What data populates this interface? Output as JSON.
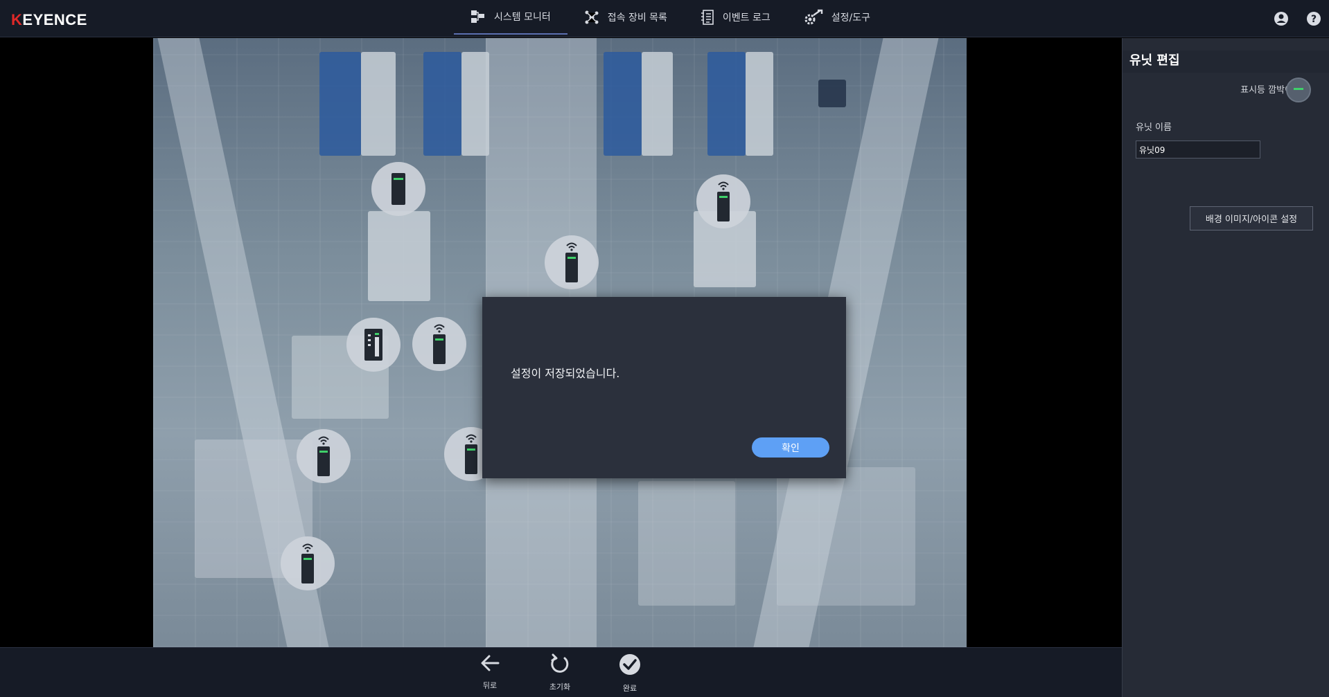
{
  "app": {
    "logo": "KEYENCE",
    "logo_k": "K",
    "logo_rest": "EYENCE"
  },
  "tabs": [
    {
      "label": "시스템 모니터",
      "icon": "system-monitor-icon",
      "active": true
    },
    {
      "label": "접속 장비 목록",
      "icon": "network-nodes-icon",
      "active": false
    },
    {
      "label": "이벤트 로그",
      "icon": "event-log-icon",
      "active": false
    },
    {
      "label": "설정/도구",
      "icon": "settings-tools-icon",
      "active": false
    }
  ],
  "header_icons": [
    "user-account-icon",
    "help-icon"
  ],
  "dialog": {
    "message": "설정이 저장되었습니다.",
    "ok_label": "확인"
  },
  "bottom_toolbar": {
    "back_label": "뒤로",
    "reset_label": "초기화",
    "done_label": "완료"
  },
  "side_panel": {
    "title": "유닛 편집",
    "blink_label": "표시등 깜박이기",
    "name_label": "유닛 이름",
    "name_value": "유닛09",
    "bg_button_label": "배경 이미지/아이콘 설정"
  },
  "units": [
    {
      "type": "terminal"
    },
    {
      "type": "wireless"
    },
    {
      "type": "wireless"
    },
    {
      "type": "controller"
    },
    {
      "type": "wireless"
    },
    {
      "type": "wireless"
    },
    {
      "type": "wireless"
    },
    {
      "type": "wireless"
    }
  ],
  "colors": {
    "accent": "#5ea0f5",
    "topbar": "#161b26",
    "panel": "#262b36",
    "dialog": "#2b303c",
    "led_green": "#3fd06a",
    "logo_red": "#e02828"
  }
}
